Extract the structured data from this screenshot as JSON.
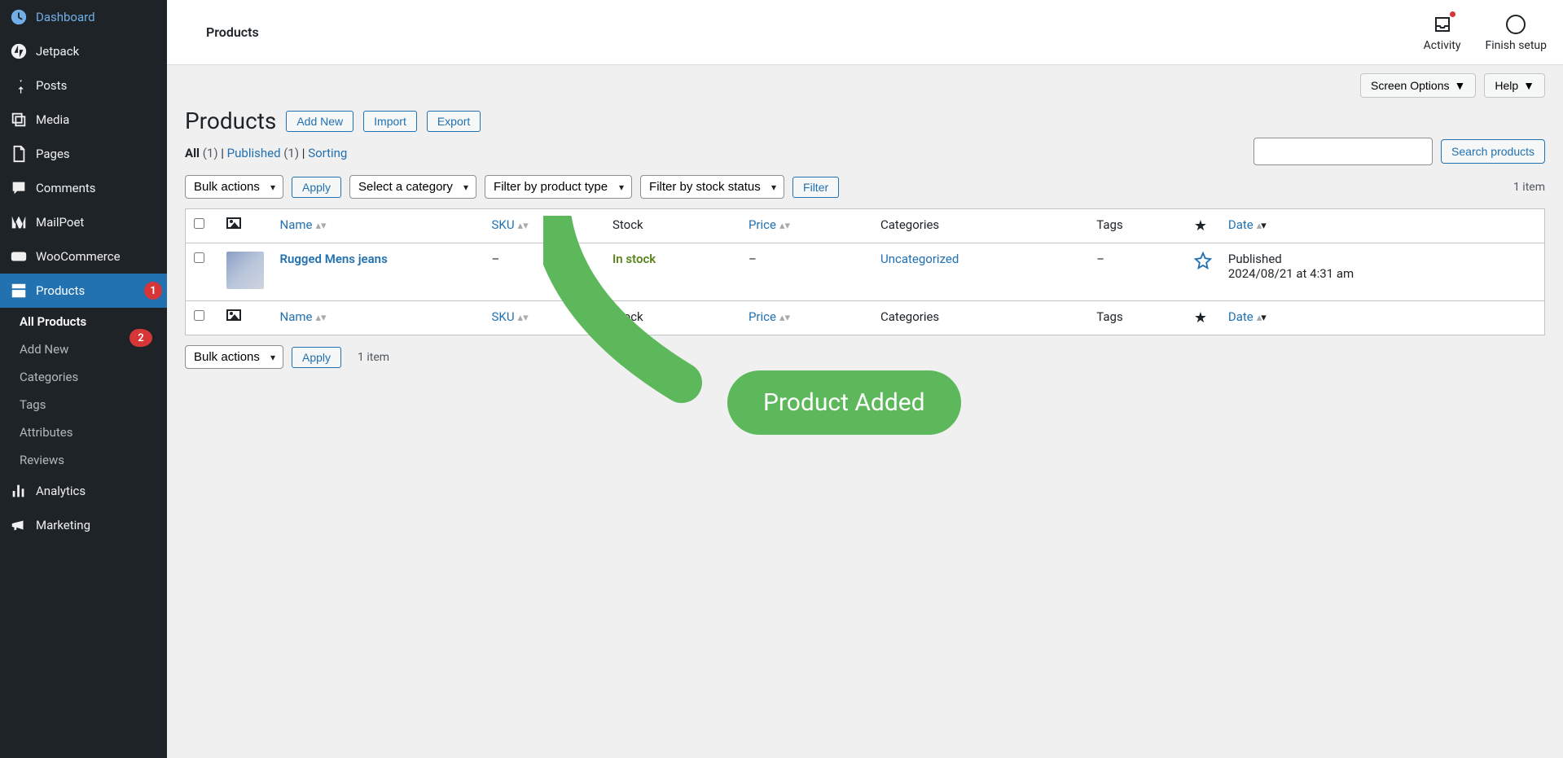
{
  "sidebar": {
    "items": [
      {
        "label": "Dashboard"
      },
      {
        "label": "Jetpack"
      },
      {
        "label": "Posts"
      },
      {
        "label": "Media"
      },
      {
        "label": "Pages"
      },
      {
        "label": "Comments"
      },
      {
        "label": "MailPoet"
      },
      {
        "label": "WooCommerce"
      },
      {
        "label": "Products",
        "badge": "1"
      },
      {
        "label": "Analytics"
      },
      {
        "label": "Marketing"
      }
    ],
    "submenu": [
      {
        "label": "All Products",
        "badge": "2"
      },
      {
        "label": "Add New"
      },
      {
        "label": "Categories"
      },
      {
        "label": "Tags"
      },
      {
        "label": "Attributes"
      },
      {
        "label": "Reviews"
      }
    ]
  },
  "topbar": {
    "title": "Products",
    "activity": "Activity",
    "finish": "Finish setup"
  },
  "tabs": {
    "screen_options": "Screen Options",
    "help": "Help"
  },
  "page": {
    "title": "Products",
    "add_new": "Add New",
    "import": "Import",
    "export": "Export"
  },
  "filters": {
    "all": "All",
    "all_count": "(1)",
    "published": "Published",
    "published_count": "(1)",
    "sorting": "Sorting",
    "sep": "  |  "
  },
  "search": {
    "button": "Search products"
  },
  "toolbar": {
    "bulk": "Bulk actions",
    "apply": "Apply",
    "category": "Select a category",
    "product_type": "Filter by product type",
    "stock_status": "Filter by stock status",
    "filter": "Filter",
    "item_count": "1 item"
  },
  "table": {
    "headers": {
      "name": "Name",
      "sku": "SKU",
      "stock": "Stock",
      "price": "Price",
      "categories": "Categories",
      "tags": "Tags",
      "date": "Date"
    },
    "rows": [
      {
        "name": "Rugged Mens jeans",
        "sku": "–",
        "stock": "In stock",
        "price": "–",
        "categories": "Uncategorized",
        "tags": "–",
        "date_status": "Published",
        "date": "2024/08/21 at 4:31 am"
      }
    ]
  },
  "callout": {
    "text": "Product Added"
  }
}
